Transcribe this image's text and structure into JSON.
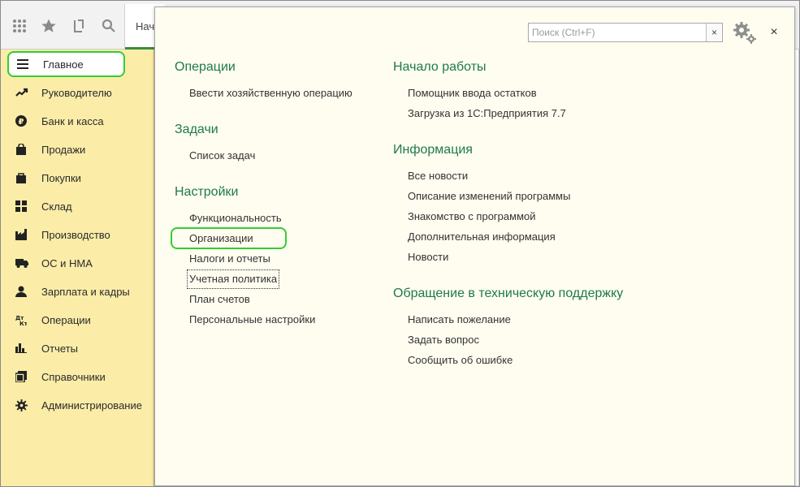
{
  "toolbar": {
    "icons": [
      "apps-grid-icon",
      "favorites-star-icon",
      "history-icon",
      "search-icon"
    ],
    "tab_home_label": "Начальная страница"
  },
  "sidebar": {
    "items": [
      {
        "label": "Главное",
        "icon": "menu-icon",
        "active": true
      },
      {
        "label": "Руководителю",
        "icon": "trend-icon"
      },
      {
        "label": "Банк и касса",
        "icon": "ruble-icon"
      },
      {
        "label": "Продажи",
        "icon": "bag-icon"
      },
      {
        "label": "Покупки",
        "icon": "cart-icon"
      },
      {
        "label": "Склад",
        "icon": "warehouse-icon"
      },
      {
        "label": "Производство",
        "icon": "factory-icon"
      },
      {
        "label": "ОС и НМА",
        "icon": "truck-icon"
      },
      {
        "label": "Зарплата и кадры",
        "icon": "people-icon"
      },
      {
        "label": "Операции",
        "icon": "operations-icon"
      },
      {
        "label": "Отчеты",
        "icon": "bar-chart-icon"
      },
      {
        "label": "Справочники",
        "icon": "books-icon"
      },
      {
        "label": "Администрирование",
        "icon": "gear-icon"
      }
    ]
  },
  "panel": {
    "search": {
      "placeholder": "Поиск (Ctrl+F)",
      "value": "",
      "clear": "×"
    },
    "close": "×",
    "left": {
      "operations": {
        "title": "Операции",
        "links": [
          "Ввести хозяйственную операцию"
        ]
      },
      "tasks": {
        "title": "Задачи",
        "links": [
          "Список задач"
        ]
      },
      "settings": {
        "title": "Настройки",
        "links": [
          "Функциональность",
          "Организации",
          "Налоги и отчеты",
          "Учетная политика",
          "План счетов",
          "Персональные настройки"
        ]
      }
    },
    "right": {
      "start": {
        "title": "Начало работы",
        "links": [
          "Помощник ввода остатков",
          "Загрузка из 1С:Предприятия 7.7"
        ]
      },
      "info": {
        "title": "Информация",
        "links": [
          "Все новости",
          "Описание изменений программы",
          "Знакомство с программой",
          "Дополнительная информация",
          "Новости"
        ]
      },
      "support": {
        "title": "Обращение в техническую поддержку",
        "links": [
          "Написать пожелание",
          "Задать вопрос",
          "Сообщить об ошибке"
        ]
      }
    }
  },
  "colors": {
    "sidebar_bg": "#fbeca8",
    "panel_bg": "#fffdf0",
    "section_title": "#1e7a4a",
    "highlight": "#33cc33"
  }
}
